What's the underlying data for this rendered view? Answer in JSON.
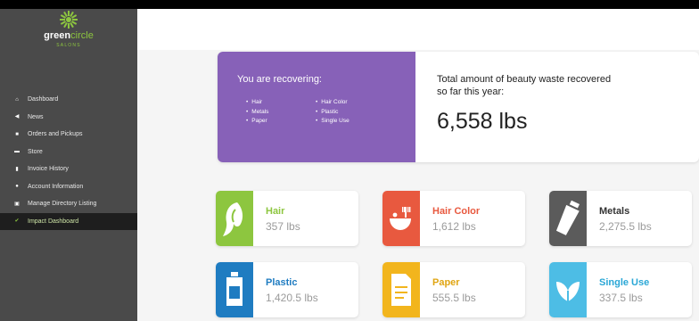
{
  "brand": {
    "name_bold": "green",
    "name_light": "circle",
    "sub": "SALONS",
    "accent": "#8dc63f"
  },
  "sidebar": {
    "items": [
      {
        "label": "Dashboard",
        "icon": "home-icon",
        "active": false
      },
      {
        "label": "News",
        "icon": "megaphone-icon",
        "active": false
      },
      {
        "label": "Orders and Pickups",
        "icon": "truck-icon",
        "active": false
      },
      {
        "label": "Store",
        "icon": "store-icon",
        "active": false
      },
      {
        "label": "Invoice History",
        "icon": "invoice-icon",
        "active": false
      },
      {
        "label": "Account Information",
        "icon": "user-icon",
        "active": false
      },
      {
        "label": "Manage Directory Listing",
        "icon": "directory-icon",
        "active": false
      },
      {
        "label": "Impact Dashboard",
        "icon": "check-icon",
        "active": true
      }
    ]
  },
  "summary": {
    "recovering_title": "You are recovering:",
    "list_col1": [
      "Hair",
      "Metals",
      "Paper"
    ],
    "list_col2": [
      "Hair Color",
      "Plastic",
      "Single Use"
    ],
    "total_label": "Total amount of beauty waste recovered so far this year:",
    "total_value": "6,558 lbs",
    "panel_color": "#8761b8"
  },
  "cards": [
    {
      "name": "Hair",
      "value": "357 lbs",
      "color": "#8dc63f",
      "icon": "hair-icon"
    },
    {
      "name": "Hair Color",
      "value": "1,612 lbs",
      "color": "#e8593f",
      "icon": "hair-color-bowl-icon"
    },
    {
      "name": "Metals",
      "value": "2,275.5 lbs",
      "color": "#5b5b5b",
      "icon": "metal-tube-icon"
    },
    {
      "name": "Plastic",
      "value": "1,420.5 lbs",
      "color": "#1f7cc1",
      "icon": "plastic-jug-icon"
    },
    {
      "name": "Paper",
      "value": "555.5 lbs",
      "color": "#f2b51d",
      "icon": "paper-document-icon"
    },
    {
      "name": "Single Use",
      "value": "337.5 lbs",
      "color": "#4dbde5",
      "icon": "single-use-leaf-icon"
    }
  ]
}
